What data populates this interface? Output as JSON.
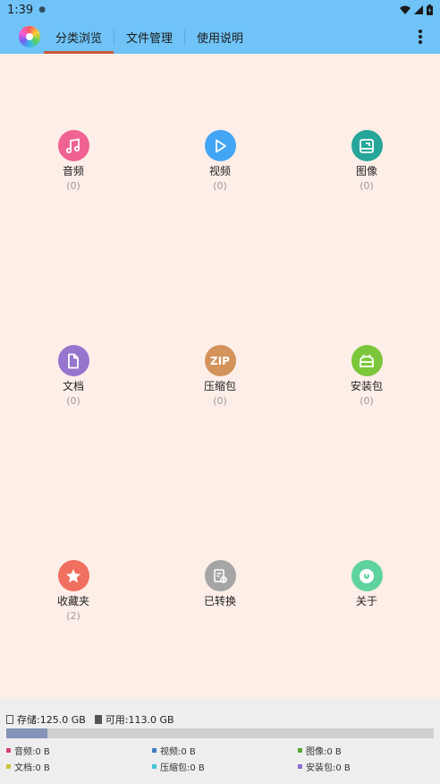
{
  "status_bar": {
    "time": "1:39"
  },
  "tabs": [
    {
      "label": "分类浏览",
      "active": true
    },
    {
      "label": "文件管理",
      "active": false
    },
    {
      "label": "使用说明",
      "active": false
    }
  ],
  "categories": [
    {
      "label": "音频",
      "count": "(0)",
      "color": "#f06292",
      "icon": "music-note-icon"
    },
    {
      "label": "视频",
      "count": "(0)",
      "color": "#42a5f5",
      "icon": "play-icon"
    },
    {
      "label": "图像",
      "count": "(0)",
      "color": "#26a69a",
      "icon": "image-icon"
    },
    {
      "label": "文档",
      "count": "(0)",
      "color": "#9575cd",
      "icon": "document-icon"
    },
    {
      "label": "压缩包",
      "count": "(0)",
      "color": "#d4935b",
      "icon": "zip-icon",
      "icon_text": "ZIP"
    },
    {
      "label": "安装包",
      "count": "(0)",
      "color": "#7cc63b",
      "icon": "android-icon"
    },
    {
      "label": "收藏夹",
      "count": "(2)",
      "color": "#f06f5e",
      "icon": "star-icon"
    },
    {
      "label": "已转换",
      "count": "",
      "color": "#a5a5a5",
      "icon": "converted-file-icon"
    },
    {
      "label": "关于",
      "count": "",
      "color": "#5ed3a0",
      "icon": "about-disc-icon"
    }
  ],
  "storage": {
    "total": "存储:125.0 GB",
    "available": "可用:113.0 GB",
    "used_fraction": 0.096
  },
  "legend": [
    {
      "label": "音频:0 B",
      "color": "#d6456a"
    },
    {
      "label": "视频:0 B",
      "color": "#3f7fbf"
    },
    {
      "label": "图像:0 B",
      "color": "#5aa83a"
    },
    {
      "label": "文档:0 B",
      "color": "#c8c43a"
    },
    {
      "label": "压缩包:0 B",
      "color": "#45c4d8"
    },
    {
      "label": "安装包:0 B",
      "color": "#8a6fd0"
    }
  ]
}
